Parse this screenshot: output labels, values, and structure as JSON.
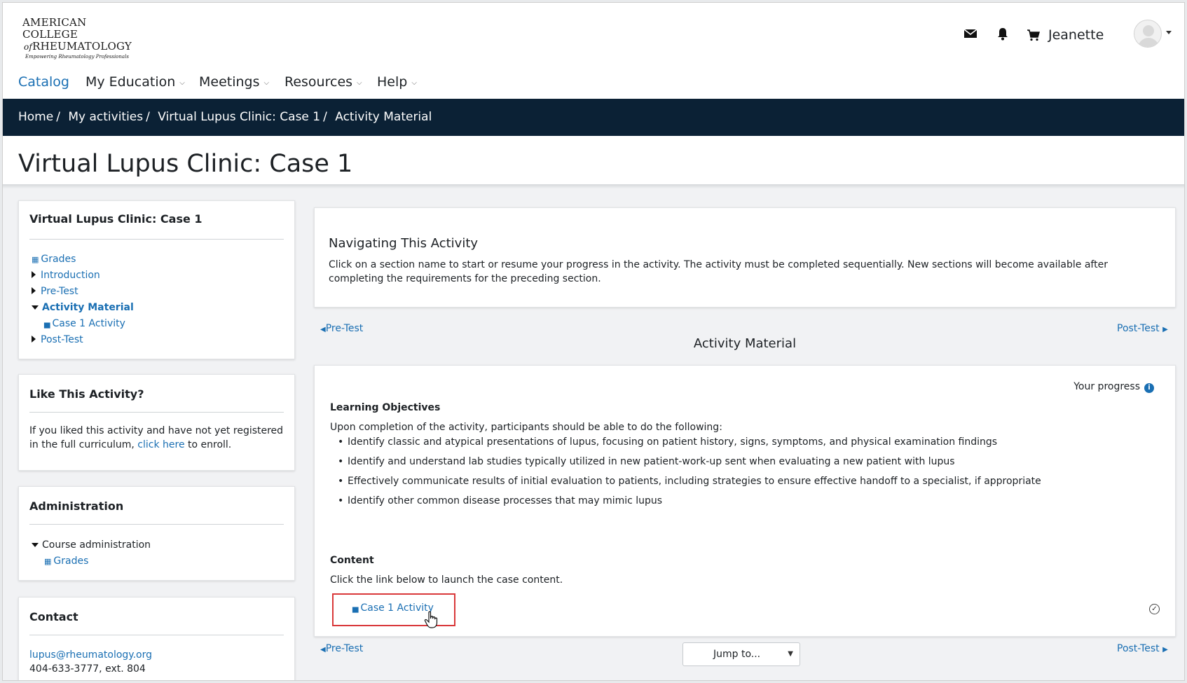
{
  "logo": {
    "line1": "AMERICAN COLLEGE",
    "line2_prefix": "of",
    "line2": "RHEUMATOLOGY",
    "tagline": "Empowering Rheumatology Professionals"
  },
  "header": {
    "icons": [
      "mail-icon",
      "bell-icon",
      "cart-icon"
    ],
    "username": "Jeanette"
  },
  "nav": {
    "catalog": "Catalog",
    "my_education": "My Education",
    "meetings": "Meetings",
    "resources": "Resources",
    "help": "Help",
    "chevron": "⌵"
  },
  "breadcrumb": {
    "items": [
      "Home",
      "My activities",
      "Virtual Lupus Clinic: Case 1",
      "Activity Material"
    ],
    "separator": "/"
  },
  "page_title": "Virtual Lupus Clinic: Case 1",
  "sidebar": {
    "course_block": {
      "title": "Virtual Lupus Clinic: Case 1",
      "items": [
        {
          "label": "Grades"
        },
        {
          "label": "Introduction"
        },
        {
          "label": "Pre-Test"
        },
        {
          "label": "Activity Material"
        },
        {
          "label": "Case 1 Activity"
        },
        {
          "label": "Post-Test"
        }
      ]
    },
    "like_block": {
      "title": "Like This Activity?",
      "text_before": "If you liked this activity and have not yet registered in the full curriculum,",
      "link": "click here",
      "text_after": "to enroll."
    },
    "admin_block": {
      "title": "Administration",
      "course_admin": "Course administration",
      "grades": "Grades"
    },
    "contact_block": {
      "title": "Contact",
      "email": "lupus@rheumatology.org",
      "phone": "404-633-3777, ext. 804"
    }
  },
  "intro_card": {
    "title": "Navigating This Activity",
    "text": "Click on a section name to start or resume your progress in the activity. The activity must be completed sequentially. New sections will become available after completing the requirements for the preceding section."
  },
  "section_nav": {
    "prev": "Pre-Test",
    "next": "Post-Test",
    "prev_arrow": "◀",
    "next_arrow": "▶",
    "title": "Activity Material"
  },
  "material": {
    "progress_label": "Your progress",
    "objectives_heading": "Learning Objectives",
    "objectives_intro": "Upon completion of the activity, participants should be able to do the following:",
    "objectives": [
      "Identify classic and atypical presentations of lupus, focusing on patient history, signs, symptoms, and physical examination findings",
      "Identify and understand lab studies typically utilized in new patient-work-up sent when evaluating a new patient with lupus",
      "Effectively communicate results of initial evaluation to patients, including strategies to ensure effective handoff to a specialist, if appropriate",
      "Identify other common disease processes that may mimic lupus"
    ],
    "content_heading": "Content",
    "content_text": "Click the link below to launch the case content.",
    "activity_link": "Case 1 Activity"
  },
  "jump_to": {
    "selected": "Jump to..."
  },
  "colors": {
    "accent": "#1a6fb3",
    "band": "#0b2135",
    "highlight": "#d9383a"
  }
}
